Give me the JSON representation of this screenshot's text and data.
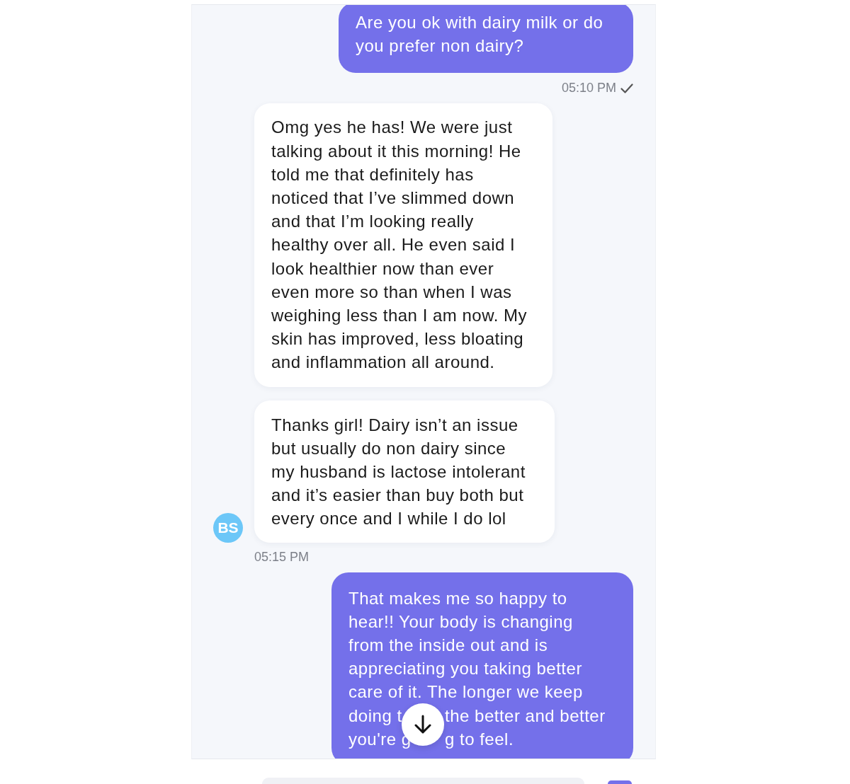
{
  "messages": [
    {
      "kind": "outgoing",
      "lines": [
        [
          "Are you ok with dairy milk or do"
        ],
        [
          "you prefer non dairy?"
        ]
      ],
      "time": "05:10 PM",
      "delivered": true
    },
    {
      "kind": "incoming",
      "lines": [
        [
          "Omg yes he has! We were just"
        ],
        [
          "talking about it this morning! He"
        ],
        [
          "told me that definitely has"
        ],
        [
          "noticed that I’ve slimmed down"
        ],
        [
          "and that I’m looking really"
        ],
        [
          "healthy over all. He even said I"
        ],
        [
          "look healthier now than ever"
        ],
        [
          "even more so than when I was"
        ],
        [
          "weighing less than I am now. My"
        ],
        [
          "skin has improved, less bloating"
        ],
        [
          "and inflammation all around."
        ]
      ]
    },
    {
      "kind": "incoming",
      "lines": [
        [
          "Thanks girl! Dairy isn’t an issue"
        ],
        [
          "but usually do non dairy since"
        ],
        [
          "my husband is lactose intolerant"
        ],
        [
          "and it’s easier than buy both but"
        ],
        [
          "every once and I while I do lol"
        ]
      ],
      "avatar": "BS",
      "time": "05:15 PM"
    },
    {
      "kind": "outgoing",
      "lines": [
        [
          "That makes me so happy to"
        ],
        [
          "hear!! Your body is changing"
        ],
        [
          "from the inside out and is"
        ],
        [
          "appreciating you taking better"
        ],
        [
          "care of it. The longer we keep"
        ],
        [
          "doing t",
          "the better and better"
        ],
        [
          "you're g",
          "g to feel."
        ]
      ]
    }
  ]
}
